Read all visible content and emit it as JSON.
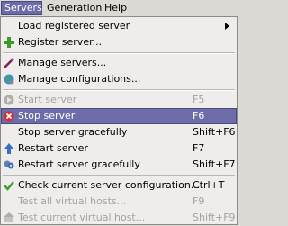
{
  "menubar": {
    "items": [
      {
        "label": "Servers",
        "active": true
      },
      {
        "label": "Generation",
        "active": false
      },
      {
        "label": "Help",
        "active": false
      }
    ]
  },
  "menu": {
    "items": [
      {
        "label": "Load registered server",
        "shortcut": "",
        "icon": "none",
        "submenu": true,
        "state": "normal"
      },
      {
        "label": "Register server...",
        "shortcut": "",
        "icon": "plus-icon",
        "state": "normal"
      },
      {
        "label": "Manage servers...",
        "shortcut": "",
        "icon": "wand-icon",
        "state": "normal"
      },
      {
        "label": "Manage configurations...",
        "shortcut": "",
        "icon": "config-globe-icon",
        "state": "normal"
      },
      {
        "label": "Start server",
        "shortcut": "F5",
        "icon": "start-icon",
        "state": "disabled"
      },
      {
        "label": "Stop server",
        "shortcut": "F6",
        "icon": "stop-icon",
        "state": "highlighted"
      },
      {
        "label": "Stop server gracefully",
        "shortcut": "Shift+F6",
        "icon": "none",
        "state": "normal"
      },
      {
        "label": "Restart server",
        "shortcut": "F7",
        "icon": "restart-icon",
        "state": "normal"
      },
      {
        "label": "Restart server gracefully",
        "shortcut": "Shift+F7",
        "icon": "restart-graceful-icon",
        "state": "normal"
      },
      {
        "label": "Check current server configuration...",
        "shortcut": "Ctrl+T",
        "icon": "check-icon",
        "state": "normal"
      },
      {
        "label": "Test all virtual hosts...",
        "shortcut": "F9",
        "icon": "none",
        "state": "disabled"
      },
      {
        "label": "Test current virtual host...",
        "shortcut": "Shift+F9",
        "icon": "test-host-icon",
        "state": "disabled"
      }
    ]
  },
  "colors": {
    "highlight": "#6d6ca8",
    "menu_bg": "#eeedeb",
    "disabled_text": "#a5a39d"
  }
}
